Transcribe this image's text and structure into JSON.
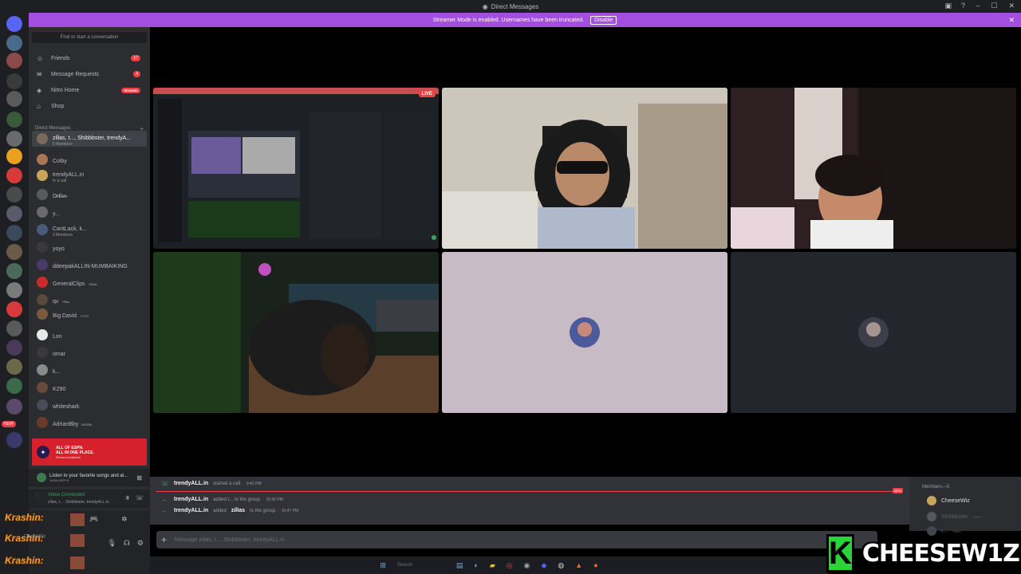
{
  "window": {
    "title": "Direct Messages"
  },
  "banner": {
    "text": "Streamer Mode is enabled. Usernames have been truncated.",
    "button": "Disable",
    "color": "#a34ee0"
  },
  "sidebar": {
    "search_placeholder": "Find or start a conversation",
    "nav": [
      {
        "label": "Friends",
        "icon": "friends-icon",
        "count": "17"
      },
      {
        "label": "Message Requests",
        "icon": "envelope-icon",
        "count": "4"
      },
      {
        "label": "Nitro Home",
        "icon": "nitro-icon",
        "badge": "REWARD"
      },
      {
        "label": "Shop",
        "icon": "shop-icon"
      }
    ],
    "dm_header": "Direct Messages",
    "dms": [
      {
        "name": "zillas, t..., Shibbbster, trendyA...",
        "sub": "5 Members",
        "color": "#7a6a5a",
        "active": true
      },
      {
        "name": "Colby",
        "sub": "",
        "color": "#a87654"
      },
      {
        "name": "trendyALL.in",
        "sub": "In a call",
        "color": "#c9a55a"
      },
      {
        "name": "D̶r̶E̶w̶",
        "sub": "",
        "color": "#5a5a5a"
      },
      {
        "name": "y...",
        "sub": "",
        "color": "#6a6a6a"
      },
      {
        "name": "CantLack, k...",
        "sub": "3 Members",
        "color": "#4a5a7a"
      },
      {
        "name": "yoyo",
        "sub": "",
        "color": "#3a3a3a"
      },
      {
        "name": "ddeepakALLIN-MUMBAIKING",
        "sub": "",
        "color": "#4a3a6a"
      },
      {
        "name": "GeneralClips",
        "sub": "",
        "tag": "⚡BAU",
        "color": "#c92a2a"
      },
      {
        "name": "qv",
        "sub": "",
        "tag": "⚡Rex",
        "color": "#5a4a3a"
      },
      {
        "name": "Big David",
        "sub": "",
        "tag": "⚡YTG",
        "color": "#7a5a3a"
      },
      {
        "name": "Lon",
        "sub": "",
        "color": "#e8e8e8"
      },
      {
        "name": "omar",
        "sub": "",
        "color": "#3a3a3a"
      },
      {
        "name": "k...",
        "sub": "",
        "color": "#8a8a8a"
      },
      {
        "name": "K290",
        "sub": "",
        "color": "#6a4a3a"
      },
      {
        "name": "whiteshark",
        "sub": "",
        "color": "#4a4a5a"
      },
      {
        "name": "AdrianBby",
        "sub": "",
        "tag": "MOON",
        "color": "#6a3a2a"
      }
    ],
    "promo": {
      "line1": "ALL OF ESPN.",
      "line1b": "ALL IN ONE PLACE.",
      "line2": "Reward Available"
    },
    "now_playing": {
      "line1": "Listen to your favorite songs and al...",
      "line2": "1440x 60FPS"
    },
    "voice": {
      "status": "Video Connected",
      "channel": "zillas, t..., Shibbbster, trendyALL.in"
    },
    "user": {
      "name1": "Krashin:",
      "name2": "Krashin:",
      "name3": "Krashin:",
      "sub": "CheeseW1z"
    }
  },
  "call": {
    "live_label": "LIVE"
  },
  "chat": {
    "messages": [
      {
        "who": "trendyALL.in",
        "text": "started a call.",
        "time": "9:43 PM"
      },
      {
        "who": "trendyALL.in",
        "text": "added t... to the group.",
        "time": "10:42 PM"
      },
      {
        "who": "trendyALL.in",
        "text": "added",
        "target": "zillas",
        "text2": "to the group.",
        "time": "10:47 PM"
      }
    ],
    "new_label": "NEW",
    "composer_placeholder": "Message zillas, t..., Shibbbster, trendyALL.in"
  },
  "members": {
    "header": "Members—5",
    "list": [
      {
        "name": "CheeseWiz",
        "tag": ""
      },
      {
        "name": "Shibbbster",
        "tag": "⚡NOO"
      },
      {
        "name": "t...",
        "tag": "⚡BAU"
      }
    ]
  },
  "taskbar": {
    "search": "Search"
  },
  "overlay": {
    "k": "K",
    "word": "CHEESEW1Z"
  }
}
